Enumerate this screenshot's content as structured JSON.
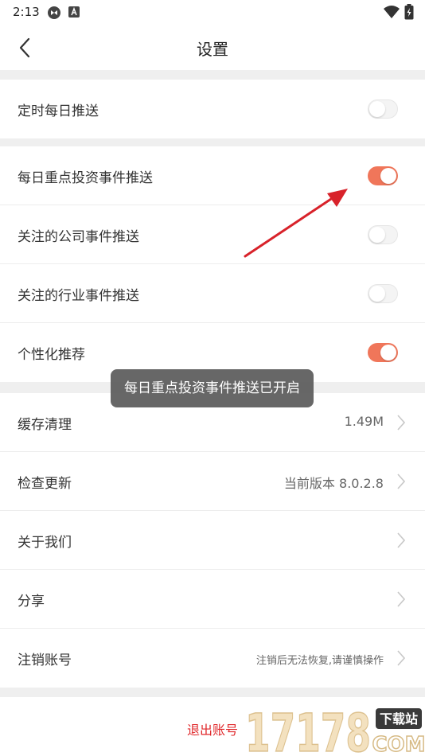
{
  "status_bar": {
    "time": "2:13"
  },
  "header": {
    "title": "设置"
  },
  "groups": [
    {
      "rows": [
        {
          "label": "定时每日推送",
          "type": "toggle",
          "on": false
        }
      ]
    },
    {
      "rows": [
        {
          "label": "每日重点投资事件推送",
          "type": "toggle",
          "on": true
        },
        {
          "label": "关注的公司事件推送",
          "type": "toggle",
          "on": false
        },
        {
          "label": "关注的行业事件推送",
          "type": "toggle",
          "on": false
        },
        {
          "label": "个性化推荐",
          "type": "toggle",
          "on": true
        }
      ]
    },
    {
      "rows": [
        {
          "label": "缓存清理",
          "type": "link",
          "value": "1.49M"
        },
        {
          "label": "检查更新",
          "type": "link",
          "value": "当前版本 8.0.2.8"
        },
        {
          "label": "关于我们",
          "type": "link",
          "value": ""
        },
        {
          "label": "分享",
          "type": "link",
          "value": ""
        },
        {
          "label": "注销账号",
          "type": "link",
          "value": "注销后无法恢复,请谨慎操作"
        }
      ]
    }
  ],
  "toast": {
    "message": "每日重点投资事件推送已开启"
  },
  "footer": {
    "logout_label": "退出账号"
  },
  "watermark": {
    "digits": "17178",
    "badge": "下载站",
    "domain": "COM"
  },
  "colors": {
    "accent": "#f0765a",
    "logout": "#e0282b",
    "arrow": "#d8222a",
    "watermark_gold": "#e9c98b"
  }
}
